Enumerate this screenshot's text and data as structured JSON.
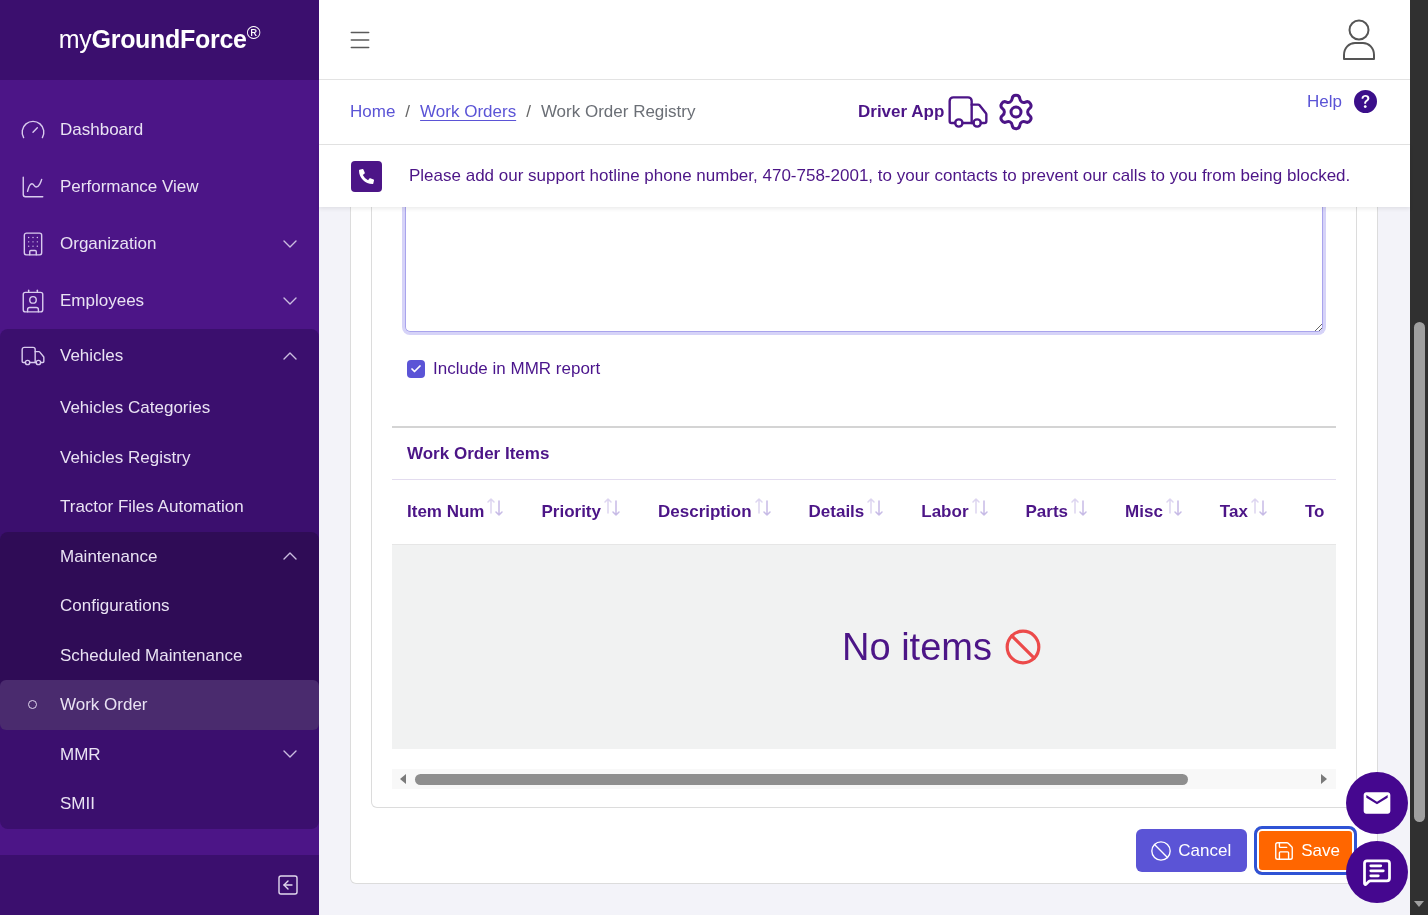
{
  "sidebar": {
    "logo": "my**GroundForce**$^{®}$",
    "items": [
      {
        "label": "Dashboard",
        "kind": "link",
        "selected": false
      },
      {
        "label": "Performance View",
        "kind": "link",
        "selected": false
      },
      {
        "label": "Organization",
        "kind": "group",
        "expanded": false,
        "selected": false
      },
      {
        "label": "Employees",
        "kind": "group",
        "expanded": false,
        "selected": false
      },
      {
        "label": "Vehicles",
        "kind": "group",
        "expanded": true,
        "selected": false,
        "children": [
          {
            "label": "Vehicles Categories",
            "kind": "link",
            "selected": false
          },
          {
            "label": "Vehicles Registry",
            "kind": "link",
            "selected": false
          },
          {
            "label": "Tractor Files Automation",
            "kind": "link",
            "selected": false
          },
          {
            "label": "Maintenance",
            "kind": "group",
            "expanded": true,
            "selected": false,
            "children": [
              {
                "label": "Configurations",
                "kind": "link",
                "selected": false
              },
              {
                "label": "Scheduled Maintenance",
                "kind": "link",
                "selected": false
              },
              {
                "label": "Work Order",
                "kind": "link",
                "selected": true
              }
            ]
          },
          {
            "label": "MMR",
            "kind": "group",
            "expanded": false,
            "selected": false
          },
          {
            "label": "SMII",
            "kind": "link",
            "selected": false
          }
        ]
      }
    ]
  },
  "breadcrumb": {
    "items": [
      {
        "label": "Home",
        "kind": "link",
        "hovered": false
      },
      {
        "label": "Work Orders",
        "kind": "link",
        "hovered": true
      },
      {
        "label": "Work Order Registry",
        "kind": "current",
        "hovered": false
      }
    ],
    "separators": [
      "/",
      "/"
    ]
  },
  "driver_app": {
    "label": "Driver App"
  },
  "help": {
    "label": "Help"
  },
  "notice": {
    "text": "Please add our support hotline phone number, 470-758-2001, to your contacts to prevent our calls to you from being blocked."
  },
  "form": {
    "notes": {
      "focused": true
    },
    "include_in_mmr": {
      "label": "Include in MMR report",
      "checked": true
    }
  },
  "work_order_items": {
    "title": "Work Order Items",
    "columns": [
      {
        "label": "Item Num",
        "truncated": false
      },
      {
        "label": "Priority",
        "truncated": false
      },
      {
        "label": "Description",
        "truncated": false
      },
      {
        "label": "Details",
        "truncated": false
      },
      {
        "label": "Labor",
        "truncated": false
      },
      {
        "label": "Parts",
        "truncated": false
      },
      {
        "label": "Misc",
        "truncated": false
      },
      {
        "label": "Tax",
        "truncated": false
      },
      {
        "label": "To",
        "truncated": true
      }
    ],
    "empty_message": "No items"
  },
  "actions": [
    {
      "label": "Cancel",
      "kind": "cancel",
      "focused": false
    },
    {
      "label": "Save",
      "kind": "save",
      "focused": true
    }
  ]
}
